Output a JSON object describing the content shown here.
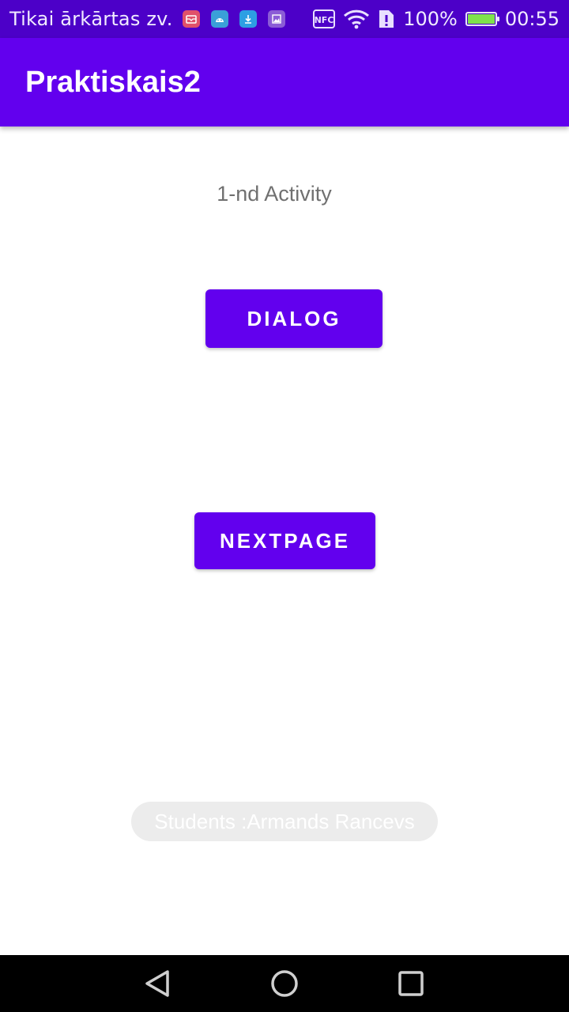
{
  "status_bar": {
    "carrier": "Tikai ārkārtas zv.",
    "nfc": "NFC",
    "battery_percent": "100%",
    "time": "00:55",
    "battery_level": 1.0,
    "notification_icons": [
      "mail-icon",
      "android-icon",
      "download-icon",
      "image-icon"
    ]
  },
  "app_bar": {
    "title": "Praktiskais2"
  },
  "main": {
    "subtitle": "1-nd Activity",
    "dialog_button": "DIALOG",
    "next_button": "NEXTPAGE",
    "toast": "Students :Armands Rancevs"
  },
  "nav_bar": {
    "icons": [
      "back-icon",
      "home-icon",
      "recents-icon"
    ]
  },
  "colors": {
    "primary": "#6200ee",
    "status_bar": "#4c00c8",
    "subtitle_text": "#707070",
    "toast_bg": "#ececec"
  }
}
